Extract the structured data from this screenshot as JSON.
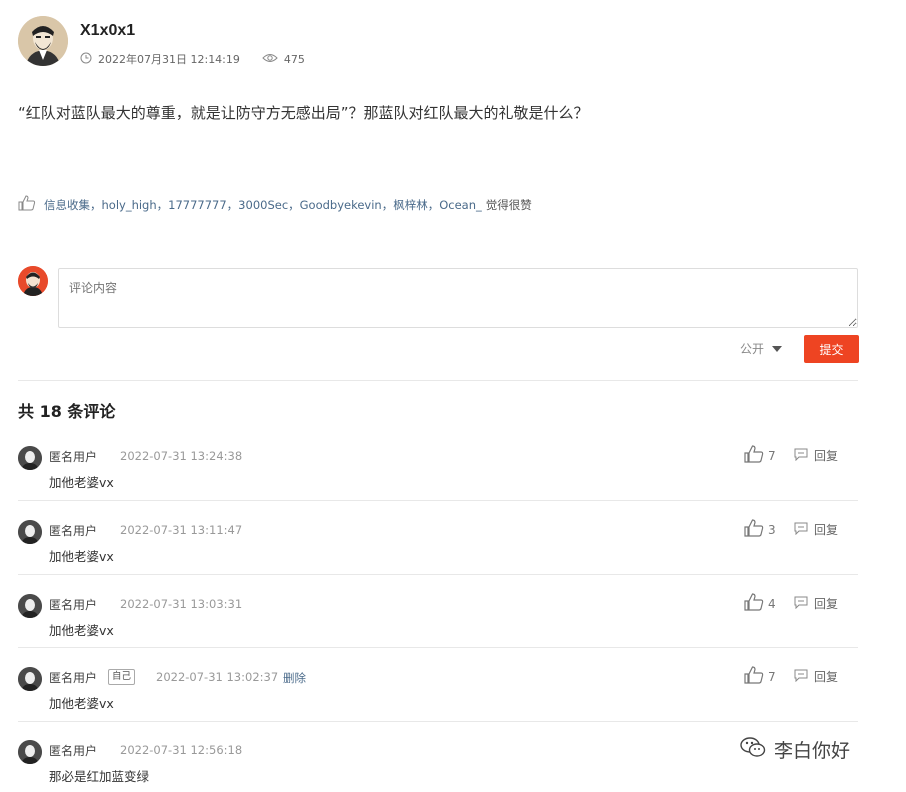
{
  "post": {
    "author": "X1x0x1",
    "datetime": "2022年07月31日 12:14:19",
    "views": "475",
    "body": "“红队对蓝队最大的尊重，就是让防守方无感出局”？那蓝队对红队最大的礼敬是什么？"
  },
  "likes": {
    "users": "信息收集，holy_high，17777777，3000Sec，Goodbyekevin，枫梓林，Ocean_",
    "suffix": "觉得很赞"
  },
  "composer": {
    "placeholder": "评论内容",
    "visibility": "公开",
    "submit": "提交"
  },
  "comments_header": "共 18 条评论",
  "comments": [
    {
      "user": "匿名用户",
      "time": "2022-07-31 13:24:38",
      "text": "加他老婆vx",
      "likes": "7",
      "reply": "回复"
    },
    {
      "user": "匿名用户",
      "time": "2022-07-31 13:11:47",
      "text": "加他老婆vx",
      "likes": "3",
      "reply": "回复"
    },
    {
      "user": "匿名用户",
      "time": "2022-07-31 13:03:31",
      "text": "加他老婆vx",
      "likes": "4",
      "reply": "回复"
    },
    {
      "user": "匿名用户",
      "self_tag": "自己",
      "time": "2022-07-31 13:02:37",
      "delete": "删除",
      "text": "加他老婆vx",
      "likes": "7",
      "reply": "回复"
    },
    {
      "user": "匿名用户",
      "time": "2022-07-31 12:56:18",
      "text": "那必是红加蓝变绿"
    }
  ],
  "watermark": "李白你好",
  "colors": {
    "accent": "#ee4422",
    "link": "#4a6a8a",
    "divider": "#e8e8e8"
  },
  "icons": [
    "clock-icon",
    "eye-icon",
    "thumbs-up-icon",
    "reply-icon",
    "wechat-icon"
  ]
}
